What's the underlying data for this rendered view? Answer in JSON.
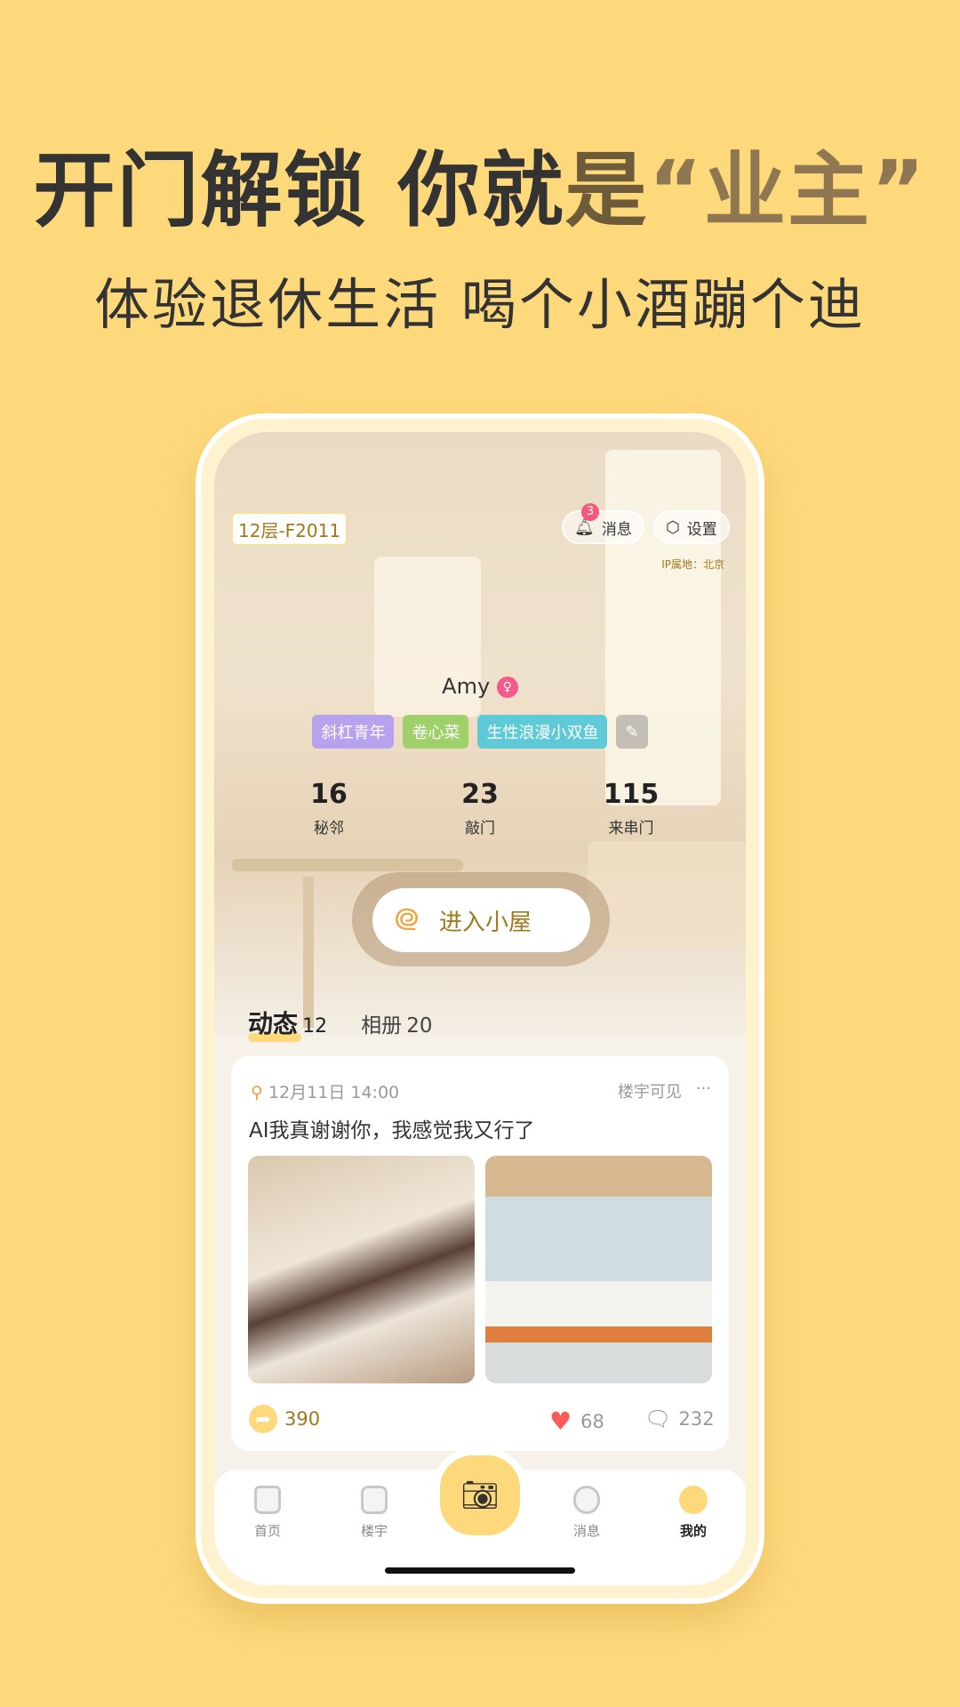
{
  "headline": {
    "part1": "开门解锁 你就",
    "part2": "是",
    "part3": "“业主”",
    "subtitle": "体验退休生活 喝个小酒蹦个迪"
  },
  "profile": {
    "floor": "12层-F2011",
    "messages_label": "消息",
    "messages_badge": "3",
    "settings_label": "设置",
    "ip_location": "IP属地：北京",
    "name": "Amy",
    "tags": [
      {
        "label": "斜杠青年",
        "color": "#b7a2f0"
      },
      {
        "label": "卷心菜",
        "color": "#9fd06a"
      },
      {
        "label": "生性浪漫小双鱼",
        "color": "#5ecad8"
      }
    ],
    "stats": [
      {
        "value": "16",
        "label": "秘邻"
      },
      {
        "value": "23",
        "label": "敲门"
      },
      {
        "value": "115",
        "label": "来串门"
      }
    ],
    "enter_button": "进入小屋"
  },
  "tabs": [
    {
      "label": "动态",
      "count": "12"
    },
    {
      "label": "相册",
      "count": "20"
    }
  ],
  "post": {
    "time": "12月11日 14:00",
    "visibility": "楼宇可见",
    "more": "···",
    "text": "AI我真谢谢你，我感觉我又行了",
    "shares": "390",
    "likes": "68",
    "comments": "232"
  },
  "nav": [
    {
      "label": "首页"
    },
    {
      "label": "楼宇"
    },
    {
      "label": "消息"
    },
    {
      "label": "我的"
    }
  ],
  "colors": {
    "background": "#fed97c",
    "accent": "#fed97c",
    "brand_text": "#a07a1a"
  }
}
